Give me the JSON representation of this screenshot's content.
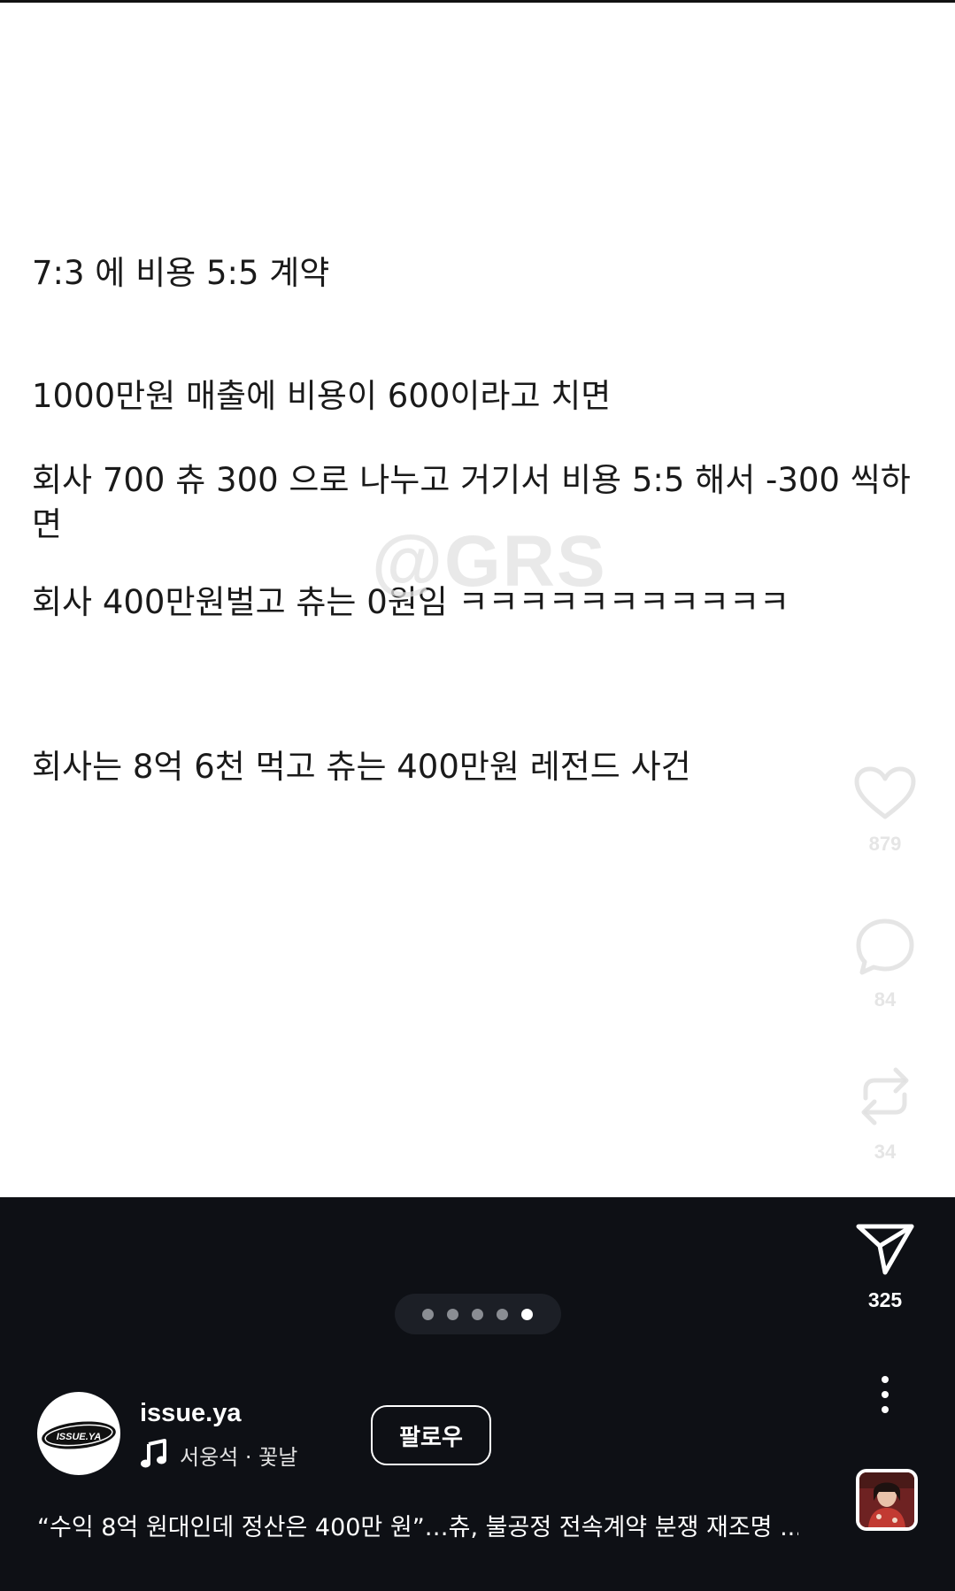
{
  "post": {
    "lines": [
      "7:3 에 비용 5:5 계약",
      "1000만원 매출에 비용이 600이라고 치면",
      "회사 700 츄 300 으로 나누고 거기서 비용 5:5 해서 -300 씩하면",
      "회사 400만원벌고 츄는 0원임 ㅋㅋㅋㅋㅋㅋㅋㅋㅋㅋㅋ",
      "회사는 8억 6천 먹고 츄는 400만원 레전드 사건"
    ],
    "watermark": "@GRS"
  },
  "actions": {
    "like_count": "879",
    "comment_count": "84",
    "repost_count": "34",
    "share_count": "325",
    "like_icon": "heart-icon",
    "comment_icon": "comment-bubble-icon",
    "repost_icon": "repost-icon",
    "share_icon": "paper-plane-icon",
    "more_icon": "more-vertical-icon"
  },
  "carousel": {
    "count": 5,
    "active_index": 4
  },
  "account": {
    "username": "issue.ya",
    "avatar_text": "ISSUE.YA",
    "music": "서웅석 · 꽃날",
    "follow_label": "팔로우"
  },
  "caption": "“수익 8억 원대인데 정산은 400만 원”…츄, 불공정 전속계약 분쟁 재조명 ...",
  "colors": {
    "background": "#0e1015",
    "post_background": "#ffffff",
    "text": "#1a1a1a",
    "pill": "#1c1f26"
  }
}
